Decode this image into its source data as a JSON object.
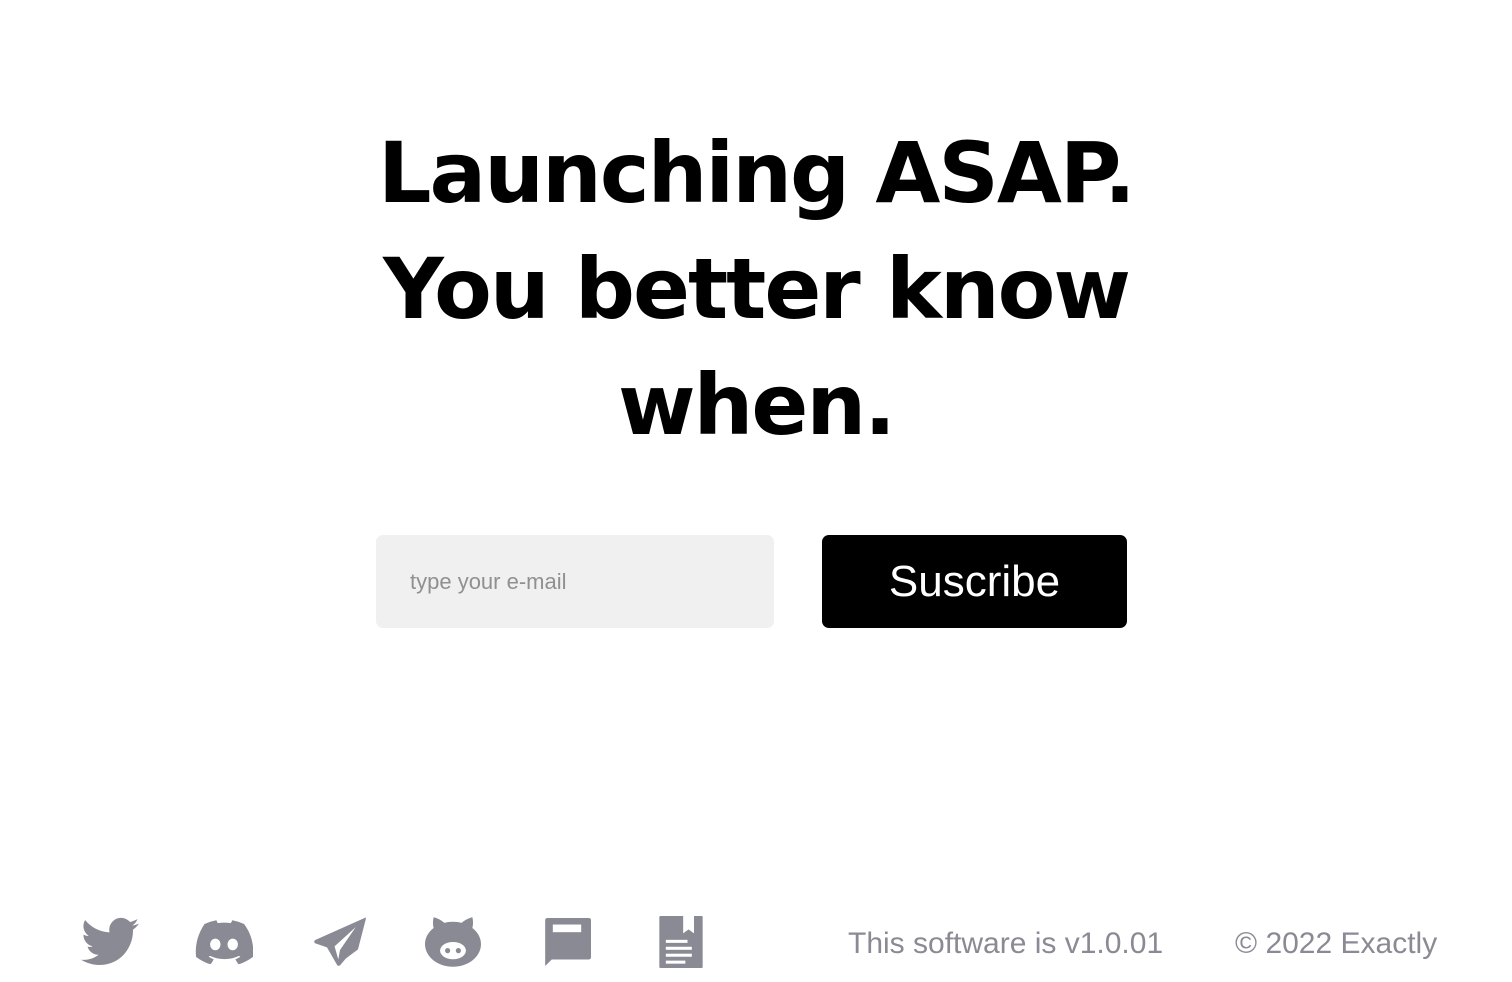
{
  "hero": {
    "line1": "Launching ASAP.",
    "line2": "You better know",
    "line3": "when."
  },
  "subscribe": {
    "email_placeholder": "type your e-mail",
    "email_value": "",
    "button_label": "Suscribe"
  },
  "footer": {
    "social_links": [
      {
        "icon": "twitter-icon"
      },
      {
        "icon": "discord-icon"
      },
      {
        "icon": "telegram-icon"
      },
      {
        "icon": "github-icon"
      },
      {
        "icon": "blog-icon"
      },
      {
        "icon": "docs-icon"
      }
    ],
    "version_text": "This software is v1.0.01",
    "copyright_text": "© 2022 Exactly"
  },
  "colors": {
    "background": "#ffffff",
    "text": "#000000",
    "input_background": "#f0f0f0",
    "button_background": "#000000",
    "button_text": "#ffffff",
    "footer_muted": "#8a8a94"
  }
}
